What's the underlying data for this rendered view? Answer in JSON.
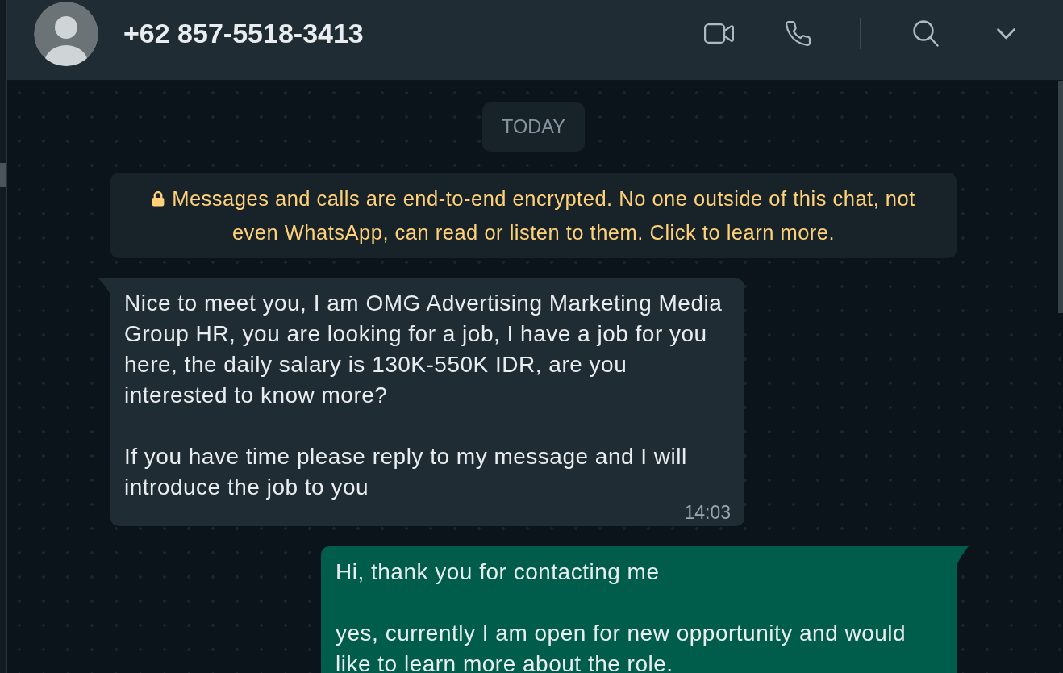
{
  "header": {
    "contact_name": "+62 857-5518-3413"
  },
  "date_divider": "TODAY",
  "encryption_notice": "Messages and calls are end-to-end encrypted. No one outside of this chat, not even WhatsApp, can read or listen to them. Click to learn more.",
  "messages": [
    {
      "kind": "incoming",
      "paragraphs": [
        "Nice to meet you, I am OMG Advertising Marketing Media Group HR, you are looking for a job, I have a job for you here, the daily salary is 130K-550K IDR, are you interested to know more?",
        "If you have time please reply to my message and I will introduce the job to you"
      ],
      "time": "14:03"
    },
    {
      "kind": "outgoing",
      "paragraphs": [
        "Hi, thank you for contacting me",
        "yes, currently I am open for new opportunity and would like to learn more about the role."
      ]
    }
  ]
}
